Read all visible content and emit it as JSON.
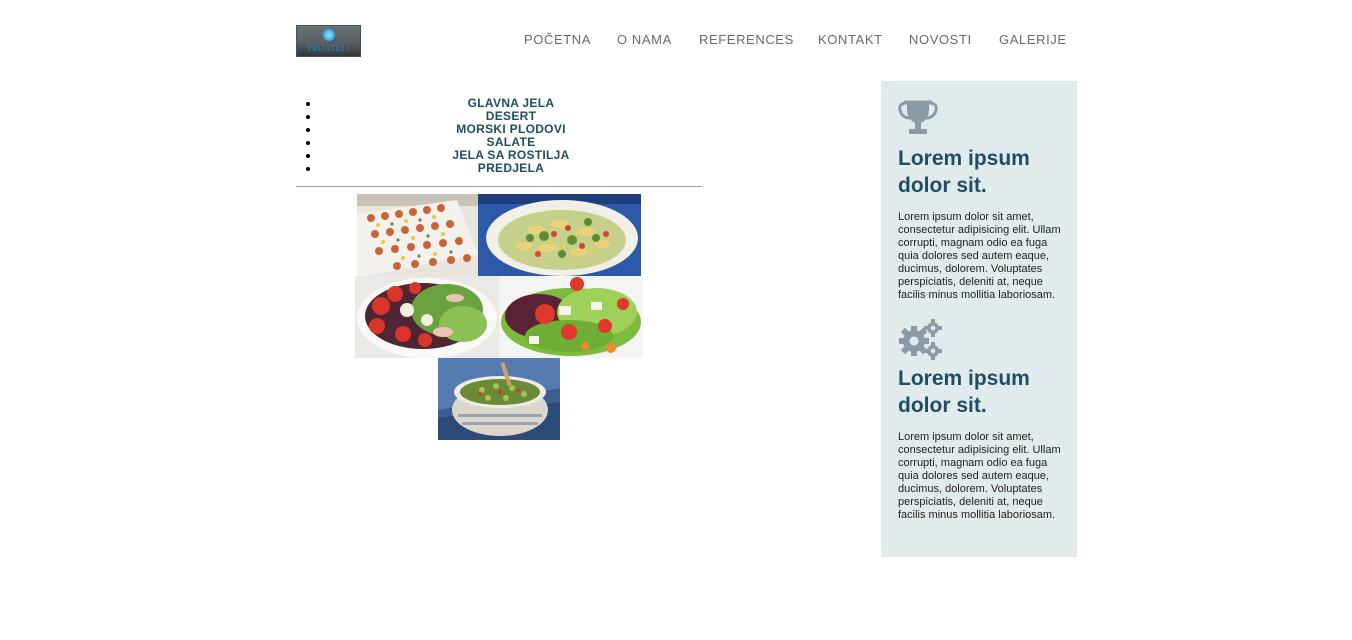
{
  "brand": {
    "logo_text": "PRIJATELJ"
  },
  "nav": {
    "items": [
      {
        "label": "POČETNA"
      },
      {
        "label": "O NAMA"
      },
      {
        "label": "REFERENCES"
      },
      {
        "label": "KONTAKT"
      },
      {
        "label": "NOVOSTI"
      },
      {
        "label": "GALERIJE"
      }
    ]
  },
  "categories": [
    {
      "label": "GLAVNA JELA"
    },
    {
      "label": "DESERT"
    },
    {
      "label": "MORSKI PLODOVI"
    },
    {
      "label": "SALATE"
    },
    {
      "label": "JELA SA ROSTILJA"
    },
    {
      "label": "PREDJELA"
    }
  ],
  "gallery": {
    "images": [
      {
        "icon": "canapes-platter-photo"
      },
      {
        "icon": "pasta-salad-photo"
      },
      {
        "icon": "tomato-salad-photo"
      },
      {
        "icon": "green-salad-photo"
      },
      {
        "icon": "tabbouleh-bowl-photo"
      }
    ]
  },
  "sidebar": {
    "features": [
      {
        "icon": "trophy-icon",
        "title": "Lorem ipsum dolor sit.",
        "text": "Lorem ipsum dolor sit amet, consectetur adipisicing elit. Ullam corrupti, magnam odio ea fuga quia dolores sed autem eaque, ducimus, dolorem. Voluptates perspiciatis, deleniti at, neque facilis minus mollitia laboriosam."
      },
      {
        "icon": "gears-icon",
        "title": "Lorem ipsum dolor sit.",
        "text": "Lorem ipsum dolor sit amet, consectetur adipisicing elit. Ullam corrupti, magnam odio ea fuga quia dolores sed autem eaque, ducimus, dolorem. Voluptates perspiciatis, deleniti at, neque facilis minus mollitia laboriosam."
      }
    ]
  },
  "colors": {
    "accent": "#1f4e62",
    "sidebar_bg": "#e1ebed",
    "icon_gray": "#8a9ba6",
    "nav_text": "#6a6a6a"
  }
}
